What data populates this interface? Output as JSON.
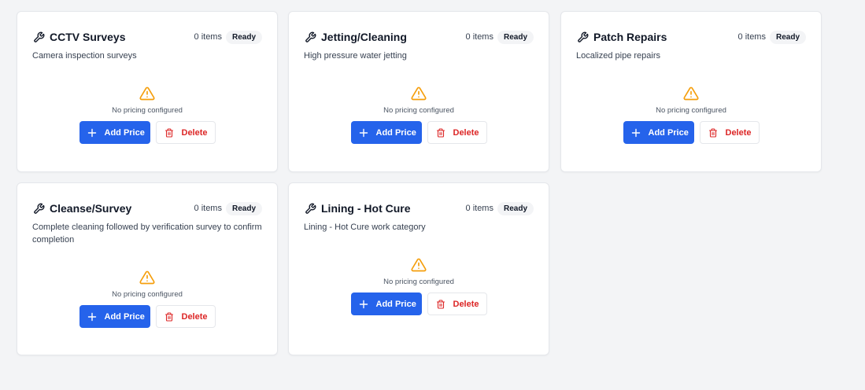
{
  "colors": {
    "primary": "#2563eb",
    "danger": "#dc2626",
    "warning": "#f59e0b",
    "badge_bg": "#f3f4f6"
  },
  "icons": {
    "category": "wrench-icon",
    "empty": "warning-triangle-icon",
    "add": "plus-icon",
    "delete": "trash-icon"
  },
  "cards": [
    {
      "title": "CCTV Surveys",
      "count": "0 items",
      "status": "Ready",
      "description": "Camera inspection surveys",
      "empty_text": "No pricing configured",
      "add_label": "Add Price",
      "delete_label": "Delete"
    },
    {
      "title": "Jetting/Cleaning",
      "count": "0 items",
      "status": "Ready",
      "description": "High pressure water jetting",
      "empty_text": "No pricing configured",
      "add_label": "Add Price",
      "delete_label": "Delete"
    },
    {
      "title": "Patch Repairs",
      "count": "0 items",
      "status": "Ready",
      "description": "Localized pipe repairs",
      "empty_text": "No pricing configured",
      "add_label": "Add Price",
      "delete_label": "Delete"
    },
    {
      "title": "Cleanse/Survey",
      "count": "0 items",
      "status": "Ready",
      "description": "Complete cleaning followed by verification survey to confirm completion",
      "empty_text": "No pricing configured",
      "add_label": "Add Price",
      "delete_label": "Delete"
    },
    {
      "title": "Lining - Hot Cure",
      "count": "0 items",
      "status": "Ready",
      "description": "Lining - Hot Cure work category",
      "empty_text": "No pricing configured",
      "add_label": "Add Price",
      "delete_label": "Delete"
    }
  ]
}
